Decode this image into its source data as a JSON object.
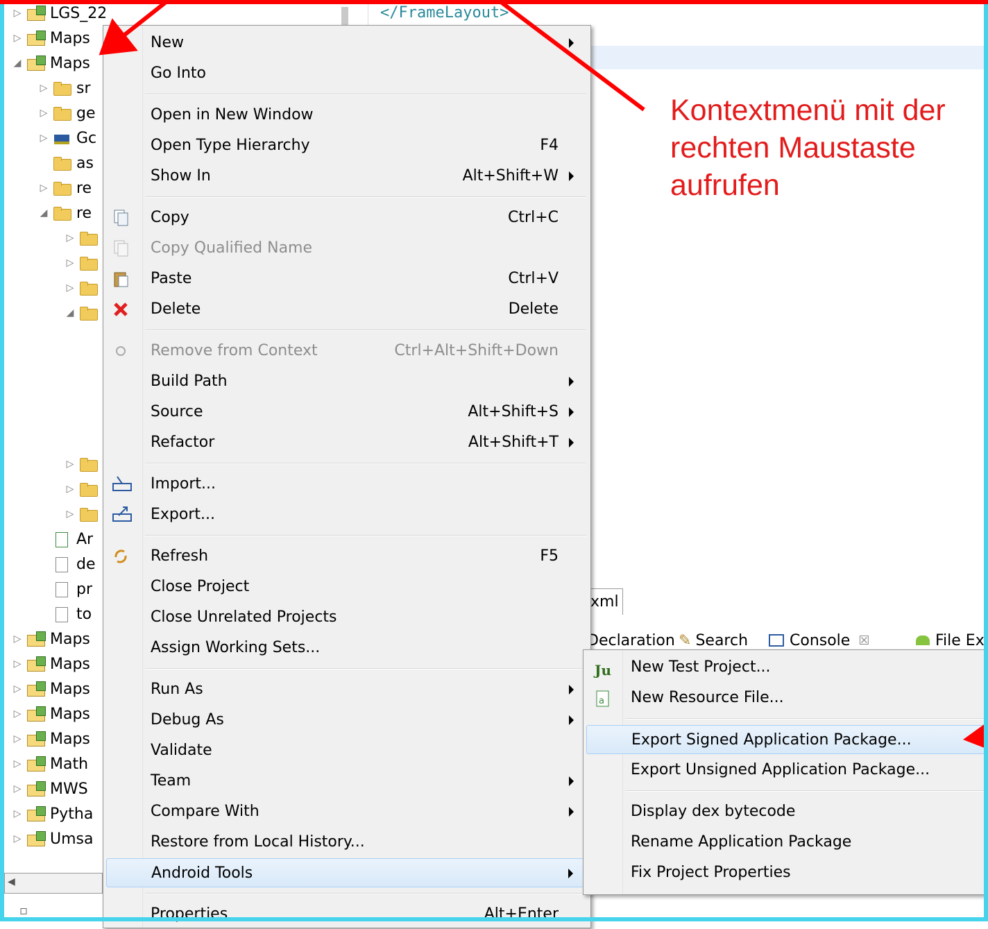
{
  "editor": {
    "code_line": "</FrameLayout>"
  },
  "explorer": {
    "rows": [
      {
        "label": "LGS_22",
        "indent": 0,
        "twisty": "▷",
        "icon": "proj"
      },
      {
        "label": "Maps",
        "indent": 0,
        "twisty": "▷",
        "icon": "proj"
      },
      {
        "label": "Maps",
        "indent": 0,
        "twisty": "◢",
        "icon": "proj"
      },
      {
        "label": "sr",
        "indent": 1,
        "twisty": "▷",
        "icon": "folder"
      },
      {
        "label": "ge",
        "indent": 1,
        "twisty": "▷",
        "icon": "folder"
      },
      {
        "label": "Gc",
        "indent": 1,
        "twisty": "▷",
        "icon": "lib"
      },
      {
        "label": "as",
        "indent": 1,
        "twisty": "",
        "icon": "folder"
      },
      {
        "label": "re",
        "indent": 1,
        "twisty": "▷",
        "icon": "folder"
      },
      {
        "label": "re",
        "indent": 1,
        "twisty": "◢",
        "icon": "folder"
      },
      {
        "label": "",
        "indent": 2,
        "twisty": "▷",
        "icon": "folder"
      },
      {
        "label": "",
        "indent": 2,
        "twisty": "▷",
        "icon": "folder"
      },
      {
        "label": "",
        "indent": 2,
        "twisty": "▷",
        "icon": "folder"
      },
      {
        "label": "",
        "indent": 2,
        "twisty": "◢",
        "icon": "folder"
      }
    ],
    "rows_lower": [
      {
        "label": "",
        "indent": 2,
        "twisty": "▷",
        "icon": "folder"
      },
      {
        "label": "",
        "indent": 2,
        "twisty": "▷",
        "icon": "folder"
      },
      {
        "label": "",
        "indent": 2,
        "twisty": "▷",
        "icon": "folder"
      },
      {
        "label": "Ar",
        "indent": 1,
        "twisty": "",
        "icon": "andr"
      },
      {
        "label": "de",
        "indent": 1,
        "twisty": "",
        "icon": "file"
      },
      {
        "label": "pr",
        "indent": 1,
        "twisty": "",
        "icon": "file"
      },
      {
        "label": "to",
        "indent": 1,
        "twisty": "",
        "icon": "file"
      },
      {
        "label": "Maps",
        "indent": 0,
        "twisty": "▷",
        "icon": "proj"
      },
      {
        "label": "Maps",
        "indent": 0,
        "twisty": "▷",
        "icon": "proj"
      },
      {
        "label": "Maps",
        "indent": 0,
        "twisty": "▷",
        "icon": "proj"
      },
      {
        "label": "Maps",
        "indent": 0,
        "twisty": "▷",
        "icon": "proj"
      },
      {
        "label": "Maps",
        "indent": 0,
        "twisty": "▷",
        "icon": "proj"
      },
      {
        "label": "Math",
        "indent": 0,
        "twisty": "▷",
        "icon": "proj"
      },
      {
        "label": "MWS",
        "indent": 0,
        "twisty": "▷",
        "icon": "proj"
      },
      {
        "label": "Pytha",
        "indent": 0,
        "twisty": "▷",
        "icon": "proj"
      },
      {
        "label": "Umsa",
        "indent": 0,
        "twisty": "▷",
        "icon": "proj"
      }
    ]
  },
  "tabs": {
    "editor_tab": "xml",
    "declaration": "Declaration",
    "search": "Search",
    "console": "Console",
    "console_close": "☒",
    "file_explorer": "File Ex"
  },
  "menu": {
    "items": [
      {
        "label": "New",
        "shortcut": "",
        "submenu": true
      },
      {
        "label": "Go Into",
        "shortcut": ""
      },
      {
        "sep": true
      },
      {
        "label": "Open in New Window",
        "shortcut": ""
      },
      {
        "label": "Open Type Hierarchy",
        "shortcut": "F4"
      },
      {
        "label": "Show In",
        "shortcut": "Alt+Shift+W",
        "submenu": true
      },
      {
        "sep": true
      },
      {
        "label": "Copy",
        "shortcut": "Ctrl+C",
        "icon": "copy"
      },
      {
        "label": "Copy Qualified Name",
        "shortcut": "",
        "disabled": true,
        "icon": "copy-disabled"
      },
      {
        "label": "Paste",
        "shortcut": "Ctrl+V",
        "icon": "paste"
      },
      {
        "label": "Delete",
        "shortcut": "Delete",
        "icon": "delete"
      },
      {
        "sep": true
      },
      {
        "label": "Remove from Context",
        "shortcut": "Ctrl+Alt+Shift+Down",
        "disabled": true,
        "icon": "remove-context"
      },
      {
        "label": "Build Path",
        "shortcut": "",
        "submenu": true
      },
      {
        "label": "Source",
        "shortcut": "Alt+Shift+S",
        "submenu": true
      },
      {
        "label": "Refactor",
        "shortcut": "Alt+Shift+T",
        "submenu": true
      },
      {
        "sep": true
      },
      {
        "label": "Import...",
        "shortcut": "",
        "icon": "import"
      },
      {
        "label": "Export...",
        "shortcut": "",
        "icon": "export"
      },
      {
        "sep": true
      },
      {
        "label": "Refresh",
        "shortcut": "F5",
        "icon": "refresh"
      },
      {
        "label": "Close Project",
        "shortcut": ""
      },
      {
        "label": "Close Unrelated Projects",
        "shortcut": ""
      },
      {
        "label": "Assign Working Sets...",
        "shortcut": ""
      },
      {
        "sep": true
      },
      {
        "label": "Run As",
        "shortcut": "",
        "submenu": true
      },
      {
        "label": "Debug As",
        "shortcut": "",
        "submenu": true
      },
      {
        "label": "Validate",
        "shortcut": ""
      },
      {
        "label": "Team",
        "shortcut": "",
        "submenu": true
      },
      {
        "label": "Compare With",
        "shortcut": "",
        "submenu": true
      },
      {
        "label": "Restore from Local History...",
        "shortcut": ""
      },
      {
        "label": "Android Tools",
        "shortcut": "",
        "submenu": true,
        "highlighted": true
      },
      {
        "sep": true
      },
      {
        "label": "Properties",
        "shortcut": "Alt+Enter"
      }
    ]
  },
  "submenu": {
    "items": [
      {
        "label": "New Test Project...",
        "icon": "junit"
      },
      {
        "label": "New Resource File...",
        "icon": "resource-file"
      },
      {
        "sep": true
      },
      {
        "label": "Export Signed Application Package...",
        "highlighted": true
      },
      {
        "label": "Export Unsigned Application Package..."
      },
      {
        "sep": true
      },
      {
        "label": "Display dex bytecode"
      },
      {
        "label": "Rename Application Package"
      },
      {
        "label": "Fix Project Properties"
      }
    ]
  },
  "annotation": {
    "text": "Kontextmenü mit der rechten Maustaste aufrufen"
  },
  "colors": {
    "annotation": "#e31b1b",
    "frame": "#46d3ec",
    "highlight": "#d9e9f9"
  }
}
